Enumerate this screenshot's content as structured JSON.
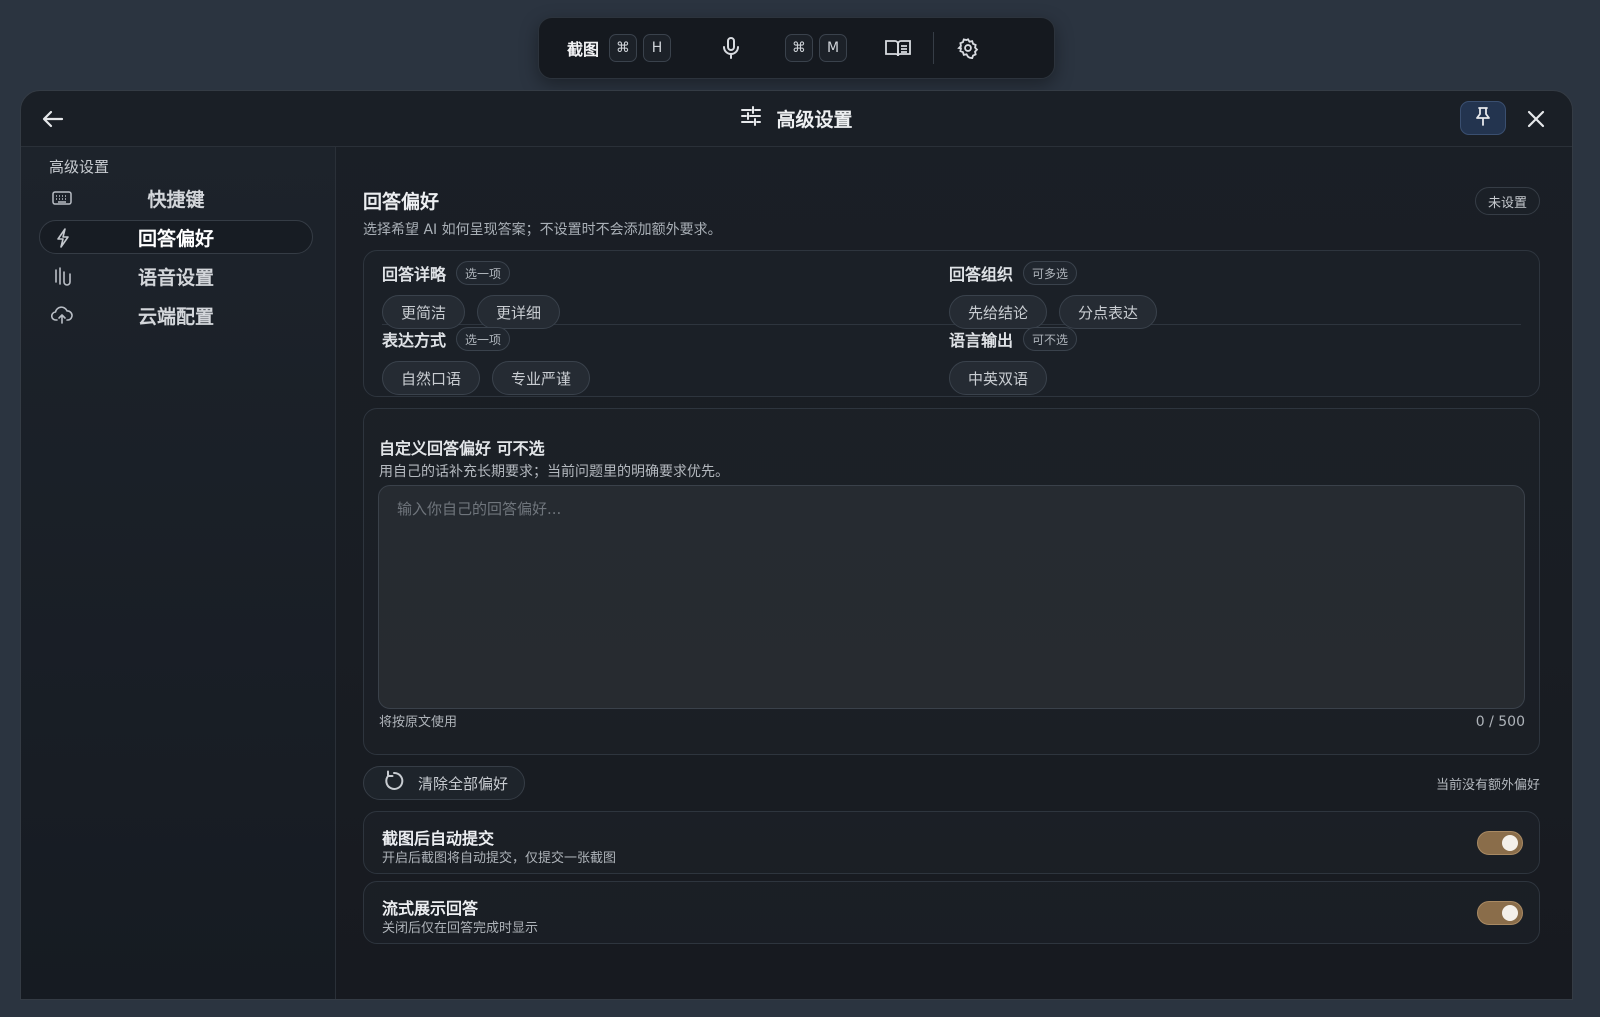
{
  "toolbar": {
    "screenshot_label": "截图",
    "cmd_key_1": "⌘",
    "screenshot_key": "H",
    "cmd_key_2": "⌘",
    "mic_key": "M"
  },
  "window": {
    "title": "高级设置"
  },
  "sidebar": {
    "heading": "高级设置",
    "items": [
      {
        "label": "快捷键",
        "icon": "keyboard-icon"
      },
      {
        "label": "回答偏好",
        "icon": "lightning-icon",
        "active": true
      },
      {
        "label": "语音设置",
        "icon": "audio-icon"
      },
      {
        "label": "云端配置",
        "icon": "cloud-upload-icon"
      }
    ]
  },
  "section": {
    "title": "回答偏好",
    "description": "选择希望 AI 如何呈现答案；不设置时不会添加额外要求。",
    "status": "未设置"
  },
  "groups": [
    {
      "title": "回答详略",
      "tag": "选一项",
      "options": [
        "更简洁",
        "更详细"
      ]
    },
    {
      "title": "回答组织",
      "tag": "可多选",
      "options": [
        "先给结论",
        "分点表达"
      ]
    },
    {
      "title": "表达方式",
      "tag": "选一项",
      "options": [
        "自然口语",
        "专业严谨"
      ]
    },
    {
      "title": "语言输出",
      "tag": "可不选",
      "options": [
        "中英双语"
      ]
    }
  ],
  "custom": {
    "title": "自定义回答偏好 可不选",
    "description": "用自己的话补充长期要求；当前问题里的明确要求优先。",
    "placeholder": "输入你自己的回答偏好...",
    "value": "",
    "use_note": "将按原文使用",
    "counter": "0 / 500"
  },
  "actions": {
    "clear_label": "清除全部偏好",
    "no_extra": "当前没有额外偏好"
  },
  "toggles": [
    {
      "title": "截图后自动提交",
      "description": "开启后截图将自动提交，仅提交一张截图",
      "on": true
    },
    {
      "title": "流式展示回答",
      "description": "关闭后仅在回答完成时显示",
      "on": true
    }
  ],
  "colors": {
    "accent_toggle": "#8a6d4a",
    "pin_active": "#23344f"
  }
}
